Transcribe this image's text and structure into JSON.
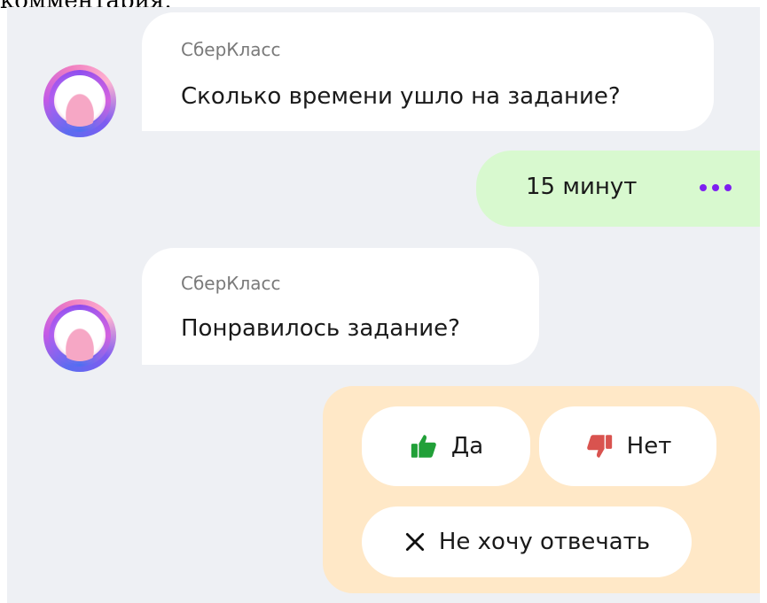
{
  "header_fragment": "комментария.",
  "bot_name": "СберКласс",
  "messages": [
    {
      "from": "bot",
      "sender": "СберКласс",
      "text": "Сколько времени ушло на задание?"
    },
    {
      "from": "user",
      "text": "15 минут"
    },
    {
      "from": "bot",
      "sender": "СберКласс",
      "text": "Понравилось задание?"
    }
  ],
  "choices": {
    "yes": "Да",
    "no": "Нет",
    "skip": "Не хочу отвечать"
  },
  "colors": {
    "chat_bg": "#eef0f4",
    "user_bubble": "#d8f9cf",
    "choices_bg": "#ffe8c7",
    "accent": "#7d1ff0",
    "thumb_up": "#21a038",
    "thumb_down": "#d9534f"
  },
  "icons": [
    "sberclass-avatar",
    "more-dots-icon",
    "thumbs-up-icon",
    "thumbs-down-icon",
    "close-icon"
  ]
}
